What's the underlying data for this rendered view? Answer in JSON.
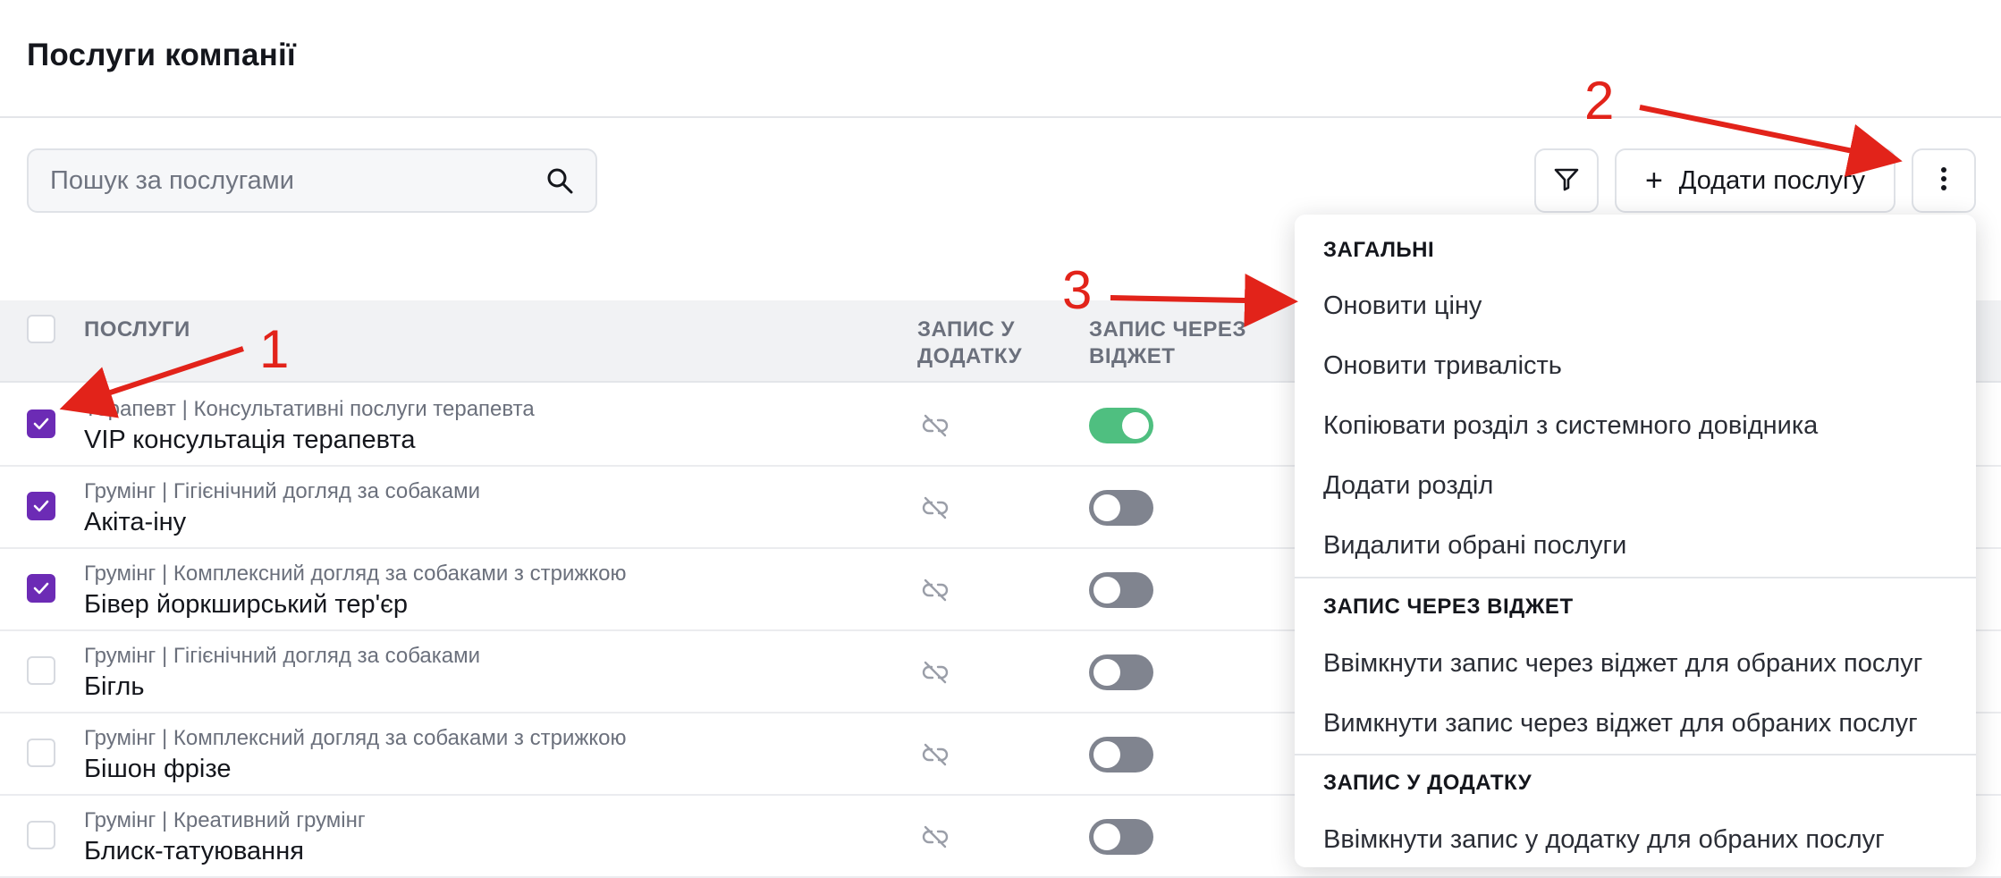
{
  "header": {
    "title": "Послуги компанії"
  },
  "search": {
    "placeholder": "Пошук за послугами"
  },
  "toolbar": {
    "filter_icon": "filter-icon",
    "add_label": "Додати послугу",
    "add_icon": "plus",
    "more_icon": "vertical-dots-icon"
  },
  "table": {
    "columns": {
      "services": "ПОСЛУГИ",
      "app": "ЗАПИС У ДОДАТКУ",
      "widget": "ЗАПИС ЧЕРЕЗ ВІДЖЕТ"
    },
    "rows": [
      {
        "category": "Терапевт | Консультативні послуги терапевта",
        "name": "VIP консультація терапевта",
        "checked": true,
        "widget_on": true
      },
      {
        "category": "Грумінг | Гігієнічний догляд за собаками",
        "name": "Акіта-іну",
        "checked": true,
        "widget_on": false
      },
      {
        "category": "Грумінг | Комплексний догляд за собаками з стрижкою",
        "name": "Бівер йоркширський тер'єр",
        "checked": true,
        "widget_on": false
      },
      {
        "category": "Грумінг | Гігієнічний догляд за собаками",
        "name": "Бігль",
        "checked": false,
        "widget_on": false
      },
      {
        "category": "Грумінг | Комплексний догляд за собаками з стрижкою",
        "name": "Бішон фрізе",
        "checked": false,
        "widget_on": false
      },
      {
        "category": "Грумінг | Креативний грумінг",
        "name": "Блиск-татуювання",
        "checked": false,
        "widget_on": false
      }
    ]
  },
  "menu": {
    "general": {
      "title": "ЗАГАЛЬНІ",
      "items": [
        "Оновити ціну",
        "Оновити тривалість",
        "Копіювати розділ з системного довідника",
        "Додати розділ",
        "Видалити обрані послуги"
      ]
    },
    "widget": {
      "title": "ЗАПИС ЧЕРЕЗ ВІДЖЕТ",
      "items": [
        "Ввімкнути запис через віджет для обраних послуг",
        "Вимкнути запис через віджет для обраних послуг"
      ]
    },
    "app": {
      "title": "ЗАПИС У ДОДАТКУ",
      "items": [
        "Ввімкнути запис у додатку для обраних послуг"
      ]
    }
  },
  "annotations": {
    "one": "1",
    "two": "2",
    "three": "3"
  },
  "colors": {
    "accent": "#6c2bb5",
    "toggle_on": "#4fbf80",
    "toggle_off": "#80848f",
    "annotation": "#e2231a"
  }
}
